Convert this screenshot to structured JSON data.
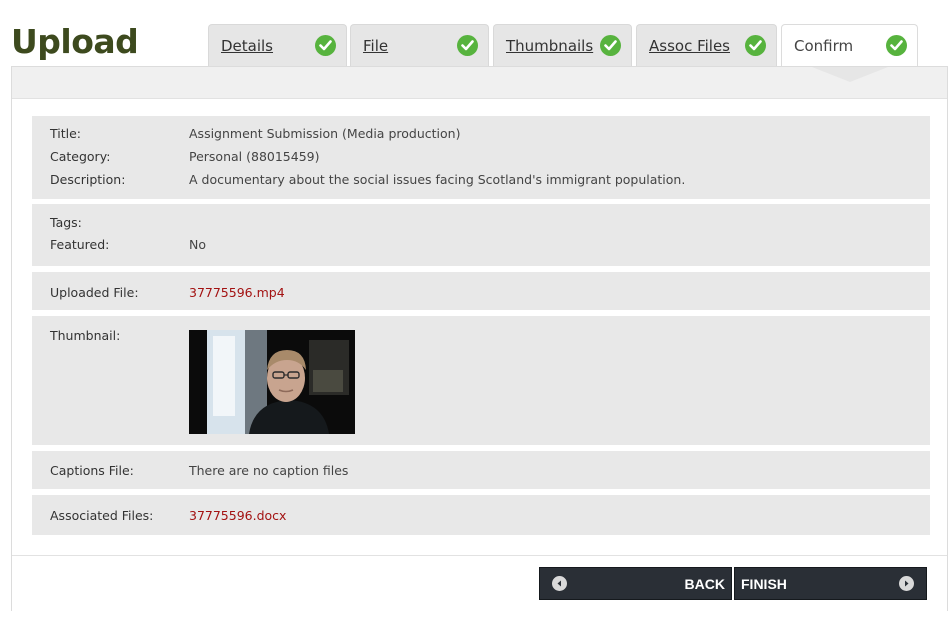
{
  "page": {
    "title": "Upload"
  },
  "tabs": [
    {
      "label": "Details",
      "complete": true,
      "active": false
    },
    {
      "label": "File",
      "complete": true,
      "active": false
    },
    {
      "label": "Thumbnails",
      "complete": true,
      "active": false
    },
    {
      "label": "Assoc Files",
      "complete": true,
      "active": false
    },
    {
      "label": "Confirm",
      "complete": true,
      "active": true
    }
  ],
  "summary": {
    "title_label": "Title:",
    "title_value": "Assignment Submission (Media production)",
    "category_label": "Category:",
    "category_value": "Personal (88015459)",
    "description_label": "Description:",
    "description_value": "A documentary about the social issues facing Scotland's immigrant population.",
    "tags_label": "Tags:",
    "tags_value": "",
    "featured_label": "Featured:",
    "featured_value": "No",
    "uploaded_file_label": "Uploaded File:",
    "uploaded_file_value": "37775596.mp4",
    "thumbnail_label": "Thumbnail:",
    "captions_label": "Captions File:",
    "captions_value": "There are no caption files",
    "associated_label": "Associated Files:",
    "associated_value": "37775596.docx"
  },
  "footer": {
    "back_label": "BACK",
    "finish_label": "FINISH"
  },
  "colors": {
    "title": "#3d4a1e",
    "check": "#57b33e",
    "link": "#a31212",
    "button": "#2a2f36",
    "section_bg": "#e8e8e8"
  },
  "icons": {
    "tab_status": "check-circle-icon",
    "back": "arrow-left-icon",
    "finish": "arrow-right-icon"
  }
}
